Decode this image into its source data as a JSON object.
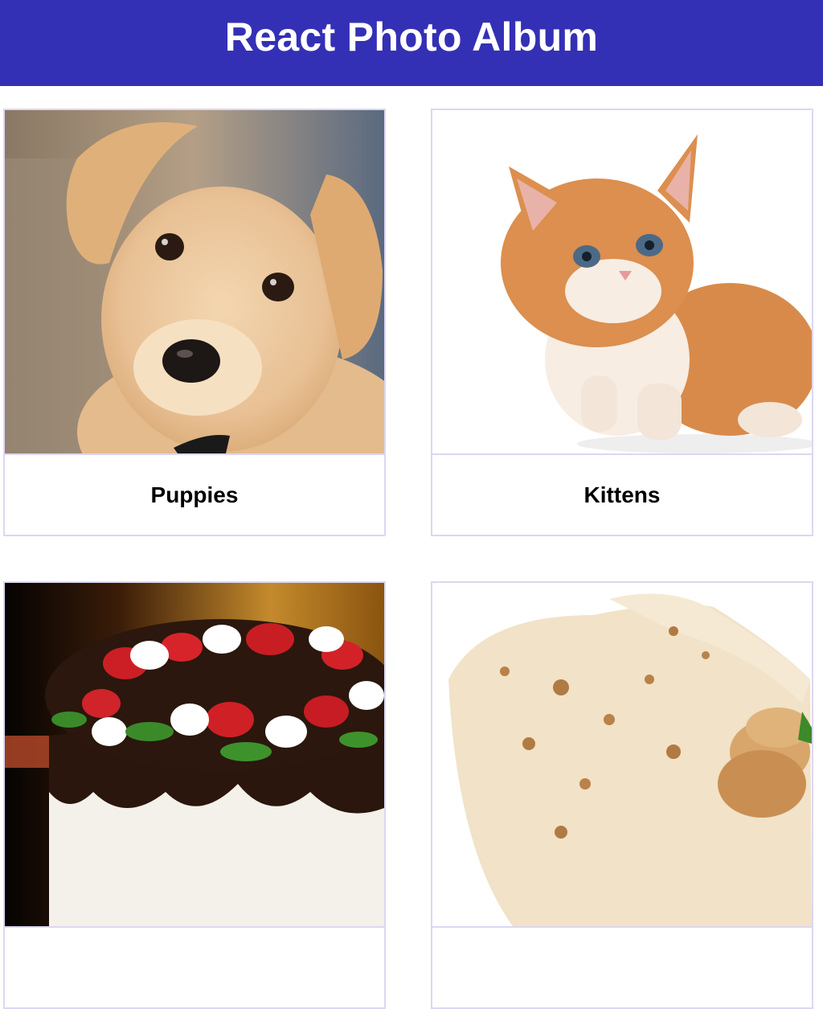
{
  "header": {
    "title": "React Photo Album",
    "background_color": "#3430b5"
  },
  "album": {
    "items": [
      {
        "label": "Puppies",
        "image": "puppy-photo"
      },
      {
        "label": "Kittens",
        "image": "kitten-photo"
      },
      {
        "label": "",
        "image": "strawberry-cake-photo"
      },
      {
        "label": "",
        "image": "burrito-wrap-photo"
      }
    ]
  },
  "colors": {
    "card_border": "#dcd7f2"
  }
}
